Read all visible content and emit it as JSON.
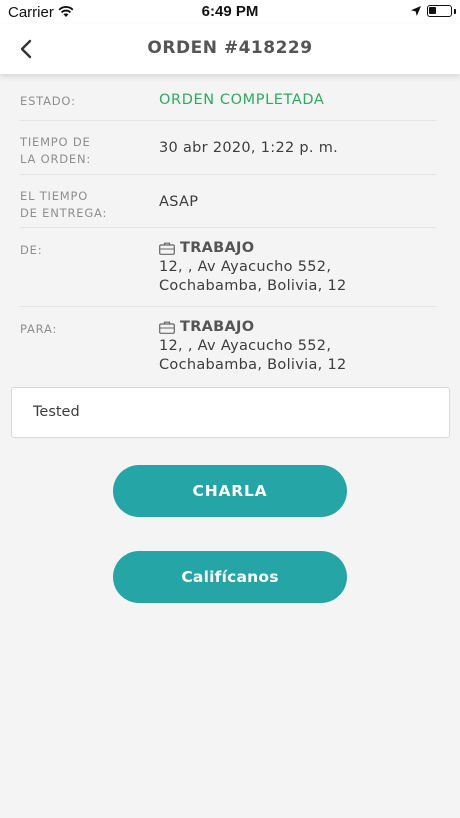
{
  "status_bar": {
    "carrier": "Carrier",
    "time": "6:49 PM",
    "battery_level": 0.35
  },
  "header": {
    "title": "ORDEN #418229"
  },
  "details": [
    {
      "label": "ESTADO:",
      "value": "ORDEN COMPLETADA"
    },
    {
      "label": "TIEMPO DE\nLA ORDEN:",
      "value": "30 abr 2020, 1:22 p. m."
    },
    {
      "label": "EL TIEMPO\nDE ENTREGA:",
      "value": "ASAP"
    },
    {
      "label": "DE:",
      "place": "TRABAJO",
      "address": "12, , Av Ayacucho 552, Cochabamba, Bolivia,  12"
    },
    {
      "label": "PARA:",
      "place": "TRABAJO",
      "address": "12, , Av Ayacucho 552, Cochabamba, Bolivia,  12"
    }
  ],
  "note": "Tested",
  "buttons": {
    "chat": "CHARLA",
    "rate": "Califícanos"
  },
  "colors": {
    "accent": "#26a5a6",
    "status_completed": "#2eaa5e"
  }
}
